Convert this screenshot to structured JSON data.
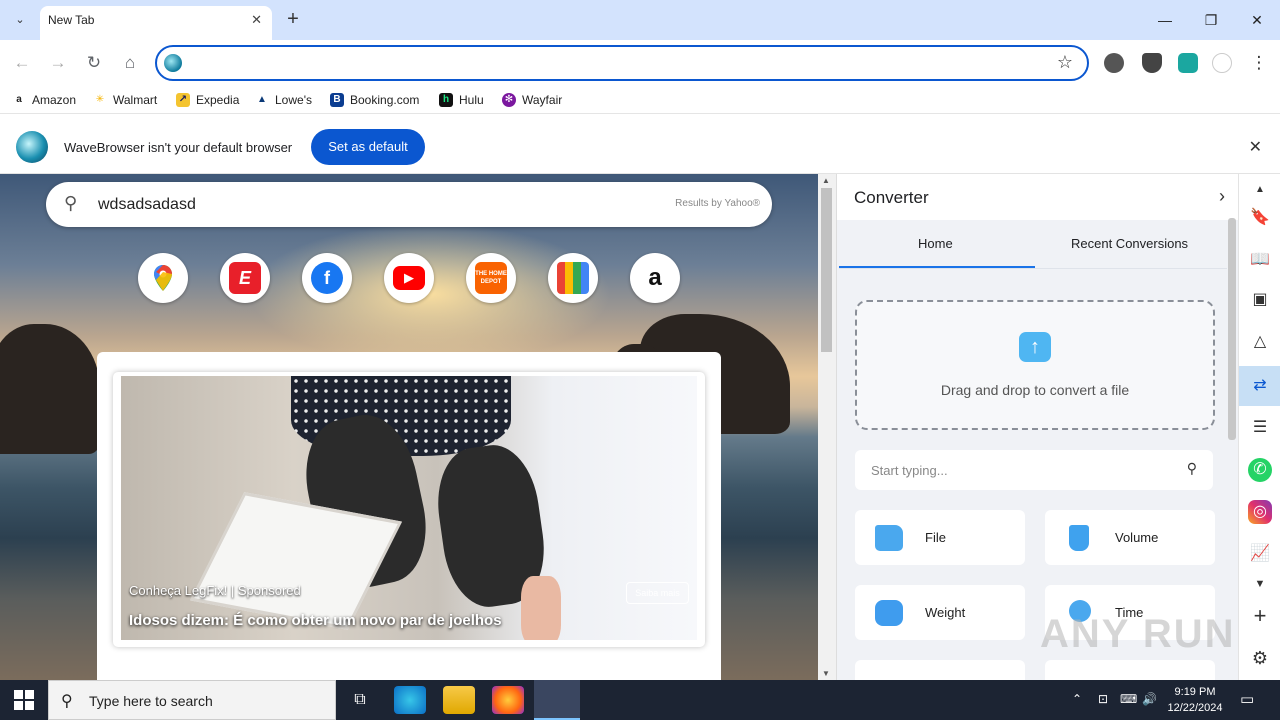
{
  "browser": {
    "tab": {
      "title": "New Tab",
      "close": "✕"
    },
    "new_tab": "+",
    "window": {
      "minimize": "—",
      "maximize": "❐",
      "close": "✕"
    },
    "nav": {
      "back": "←",
      "forward": "→",
      "reload": "↻",
      "home": "⌂"
    },
    "omnibox": {
      "value": "",
      "star": "☆"
    },
    "menu": "⋮",
    "bookmarks": [
      {
        "label": "Amazon",
        "icon": "amazon-icon",
        "color": "#222222",
        "glyph": "a"
      },
      {
        "label": "Walmart",
        "icon": "walmart-icon",
        "color": "#f5b400",
        "glyph": "✳"
      },
      {
        "label": "Expedia",
        "icon": "expedia-icon",
        "color": "#f4c430",
        "glyph": "↗"
      },
      {
        "label": "Lowe's",
        "icon": "lowes-icon",
        "color": "#0b3a78",
        "glyph": "▲"
      },
      {
        "label": "Booking.com",
        "icon": "booking-icon",
        "color": "#0b3d91",
        "glyph": "B"
      },
      {
        "label": "Hulu",
        "icon": "hulu-icon",
        "color": "#111111",
        "glyph": "h"
      },
      {
        "label": "Wayfair",
        "icon": "wayfair-icon",
        "color": "#7b189f",
        "glyph": "✻"
      }
    ]
  },
  "infobar": {
    "message": "WaveBrowser isn't your default browser",
    "button": "Set as default",
    "close": "✕"
  },
  "newtab": {
    "search": {
      "query": "wdsadsadasd",
      "provider": "Results by Yahoo®"
    },
    "shortcuts": [
      {
        "name": "google-maps",
        "glyph": "⬤",
        "bg": "#ffffff",
        "fg": "#ea4335"
      },
      {
        "name": "espn",
        "glyph": "E",
        "bg": "#e8202a",
        "fg": "#ffffff"
      },
      {
        "name": "facebook",
        "glyph": "f",
        "bg": "#1877f2",
        "fg": "#ffffff"
      },
      {
        "name": "youtube",
        "glyph": "▶",
        "bg": "#ff0000",
        "fg": "#ffffff"
      },
      {
        "name": "home-depot",
        "glyph": "THE HOME DEPOT",
        "bg": "#f96302",
        "fg": "#ffffff"
      },
      {
        "name": "shopping",
        "glyph": "▮▮",
        "bg": "#1a73e8",
        "fg": "#fbbc04"
      },
      {
        "name": "amazon",
        "glyph": "a",
        "bg": "#ffffff",
        "fg": "#111111"
      }
    ],
    "ad": {
      "brand": "Conheça LegFix! | Sponsored",
      "title": "Idosos dizem: É como obter um novo par de joelhos",
      "cta": "Saiba mais"
    }
  },
  "panel": {
    "title": "Converter",
    "chevron": "›",
    "tabs": [
      "Home",
      "Recent Conversions"
    ],
    "dropzone": "Drag and drop to convert a file",
    "search_placeholder": "Start typing...",
    "categories": [
      {
        "label": "File",
        "color": "#4aa8ee"
      },
      {
        "label": "Volume",
        "color": "#3fa2ee"
      },
      {
        "label": "Weight",
        "color": "#3f9cee"
      },
      {
        "label": "Time",
        "color": "#4aa8ee"
      }
    ]
  },
  "watermark": "ANY RUN",
  "taskbar": {
    "search_placeholder": "Type here to search",
    "time": "9:19 PM",
    "date": "12/22/2024"
  }
}
